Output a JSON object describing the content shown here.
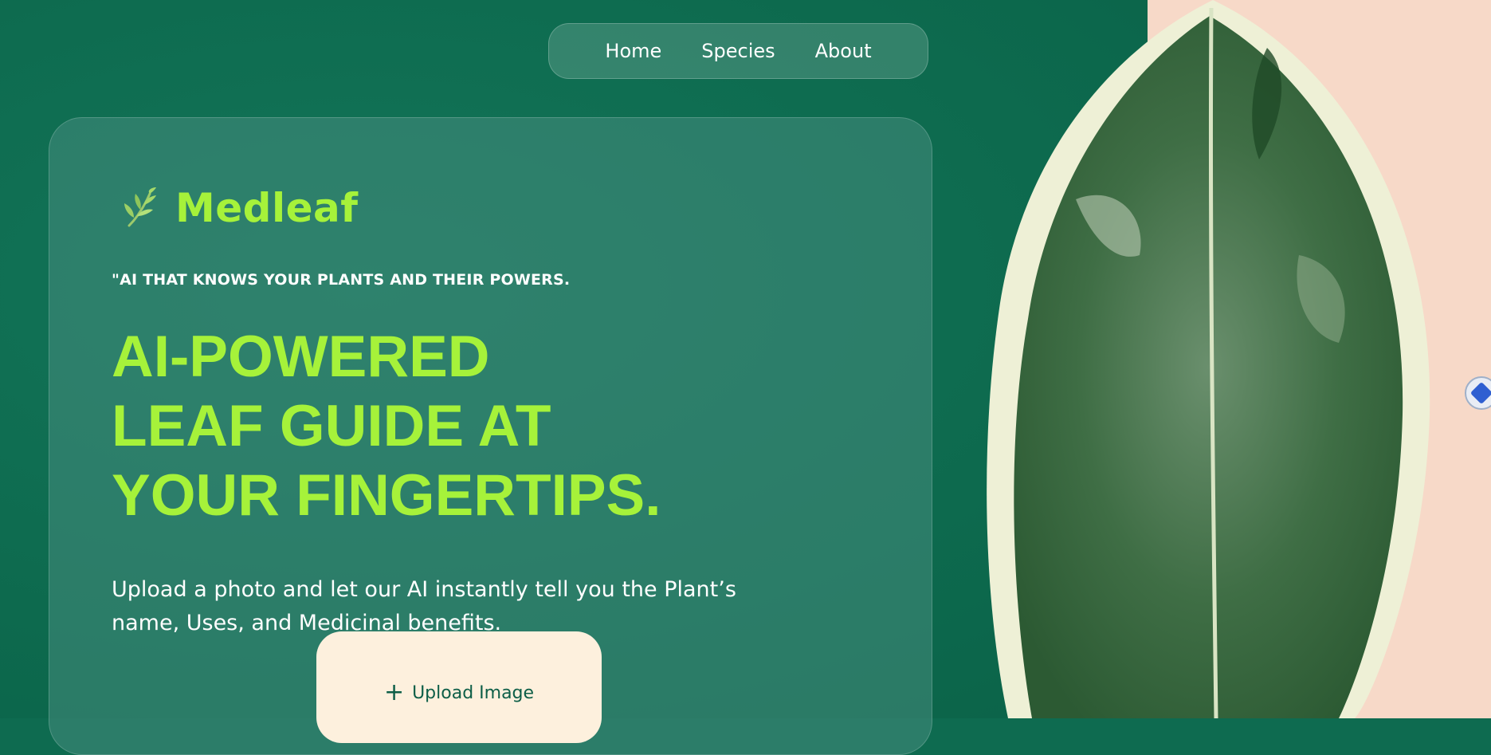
{
  "brand": {
    "name": "Medleaf",
    "icon": "leaf-sprig-icon",
    "accent": "#a6f23a"
  },
  "nav": {
    "items": [
      {
        "label": "Home"
      },
      {
        "label": "Species"
      },
      {
        "label": "About"
      }
    ]
  },
  "hero": {
    "tagline": "\"AI THAT KNOWS YOUR PLANTS AND THEIR POWERS.",
    "headline": [
      "AI-POWERED",
      "LEAF GUIDE AT",
      "YOUR FINGERTIPS."
    ],
    "description": "Upload a photo and let our AI instantly tell you the Plant’s name, Uses, and Medicinal benefits.",
    "upload_label": "Upload Image",
    "upload_icon": "plus-icon"
  },
  "colors": {
    "background": "#0e6b50",
    "card": "#3a8a76",
    "upload_bg": "#fdf0dd",
    "right_panel": "#f7d9c8"
  },
  "widget": {
    "icon": "assistant-icon"
  }
}
